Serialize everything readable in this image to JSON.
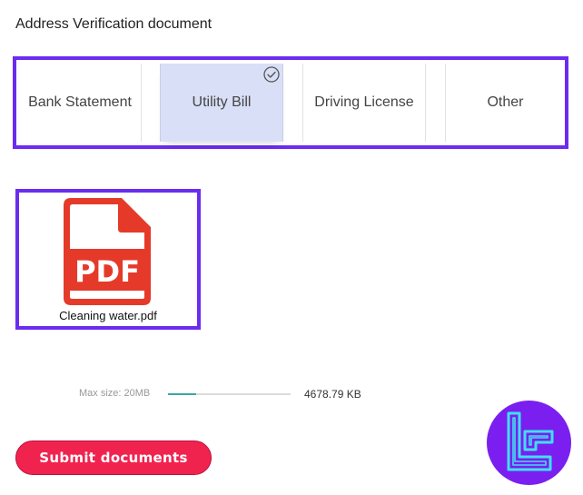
{
  "section": {
    "title": "Address Verification document"
  },
  "doc_types": [
    {
      "label": "Bank Statement",
      "selected": false
    },
    {
      "label": "Utility Bill",
      "selected": true
    },
    {
      "label": "Driving License",
      "selected": false
    },
    {
      "label": "Other",
      "selected": false
    }
  ],
  "upload": {
    "file_name": "Cleaning water.pdf",
    "icon": "pdf-file-icon",
    "icon_text": "PDF",
    "icon_color": "#e53a2a"
  },
  "limits": {
    "max_size": "Max size: 20MB",
    "file_size": "4678.79 KB",
    "progress_percent": 23,
    "progress_color": "#3aa6a6"
  },
  "actions": {
    "submit_label": "Submit documents"
  },
  "colors": {
    "highlight_border": "#6b2cf0",
    "selected_bg": "#d9dff6",
    "submit_bg": "#f0234f",
    "logo_bg": "#7a1ff0",
    "logo_accent": "#3fe0f0"
  }
}
